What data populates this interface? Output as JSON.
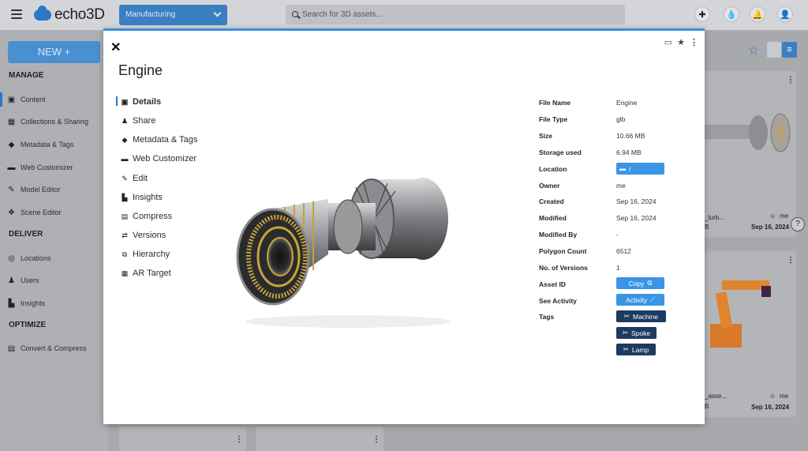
{
  "header": {
    "logo_text": "echo3D",
    "project": "Manufacturing",
    "search_placeholder": "Search for 3D assets..."
  },
  "sidebar": {
    "new_label": "NEW +",
    "sections": [
      {
        "title": "MANAGE",
        "items": [
          "Content",
          "Collections & Sharing",
          "Metadata & Tags",
          "Web Customizer",
          "Model Editor",
          "Scene Editor"
        ]
      },
      {
        "title": "DELIVER",
        "items": [
          "Locations",
          "Users",
          "Insights"
        ]
      },
      {
        "title": "OPTIMIZE",
        "items": [
          "Convert & Compress"
        ]
      }
    ]
  },
  "background_cards": [
    {
      "name": "_turb...",
      "user": "me",
      "date": "Sep 16, 2024",
      "b": "B"
    },
    {
      "name": "_asse...",
      "user": "me",
      "date": "Sep 16, 2024",
      "b": "B"
    }
  ],
  "modal": {
    "title": "Engine",
    "tabs": [
      "Details",
      "Share",
      "Metadata & Tags",
      "Web Customizer",
      "Edit",
      "Insights",
      "Compress",
      "Versions",
      "Hierarchy",
      "AR Target"
    ],
    "details": {
      "file_name": {
        "label": "File Name",
        "value": "Engine"
      },
      "file_type": {
        "label": "File Type",
        "value": "glb"
      },
      "size": {
        "label": "Size",
        "value": "10.66 MB"
      },
      "storage": {
        "label": "Storage used",
        "value": "6.94 MB"
      },
      "location": {
        "label": "Location",
        "value": "/"
      },
      "owner": {
        "label": "Owner",
        "value": "me"
      },
      "created": {
        "label": "Created",
        "value": "Sep 16, 2024"
      },
      "modified": {
        "label": "Modified",
        "value": "Sep 16, 2024"
      },
      "modified_by": {
        "label": "Modified By",
        "value": "-"
      },
      "polygon": {
        "label": "Polygon Count",
        "value": "6512"
      },
      "versions": {
        "label": "No. of Versions",
        "value": "1"
      },
      "asset_id": {
        "label": "Asset ID",
        "value": "Copy"
      },
      "activity": {
        "label": "See Activity",
        "value": "Activity"
      },
      "tags_label": "Tags",
      "tags": [
        "Machine",
        "Spoke",
        "Lamp"
      ]
    }
  },
  "colors": {
    "accent": "#3b95e6",
    "tag": "#1d3a63"
  }
}
